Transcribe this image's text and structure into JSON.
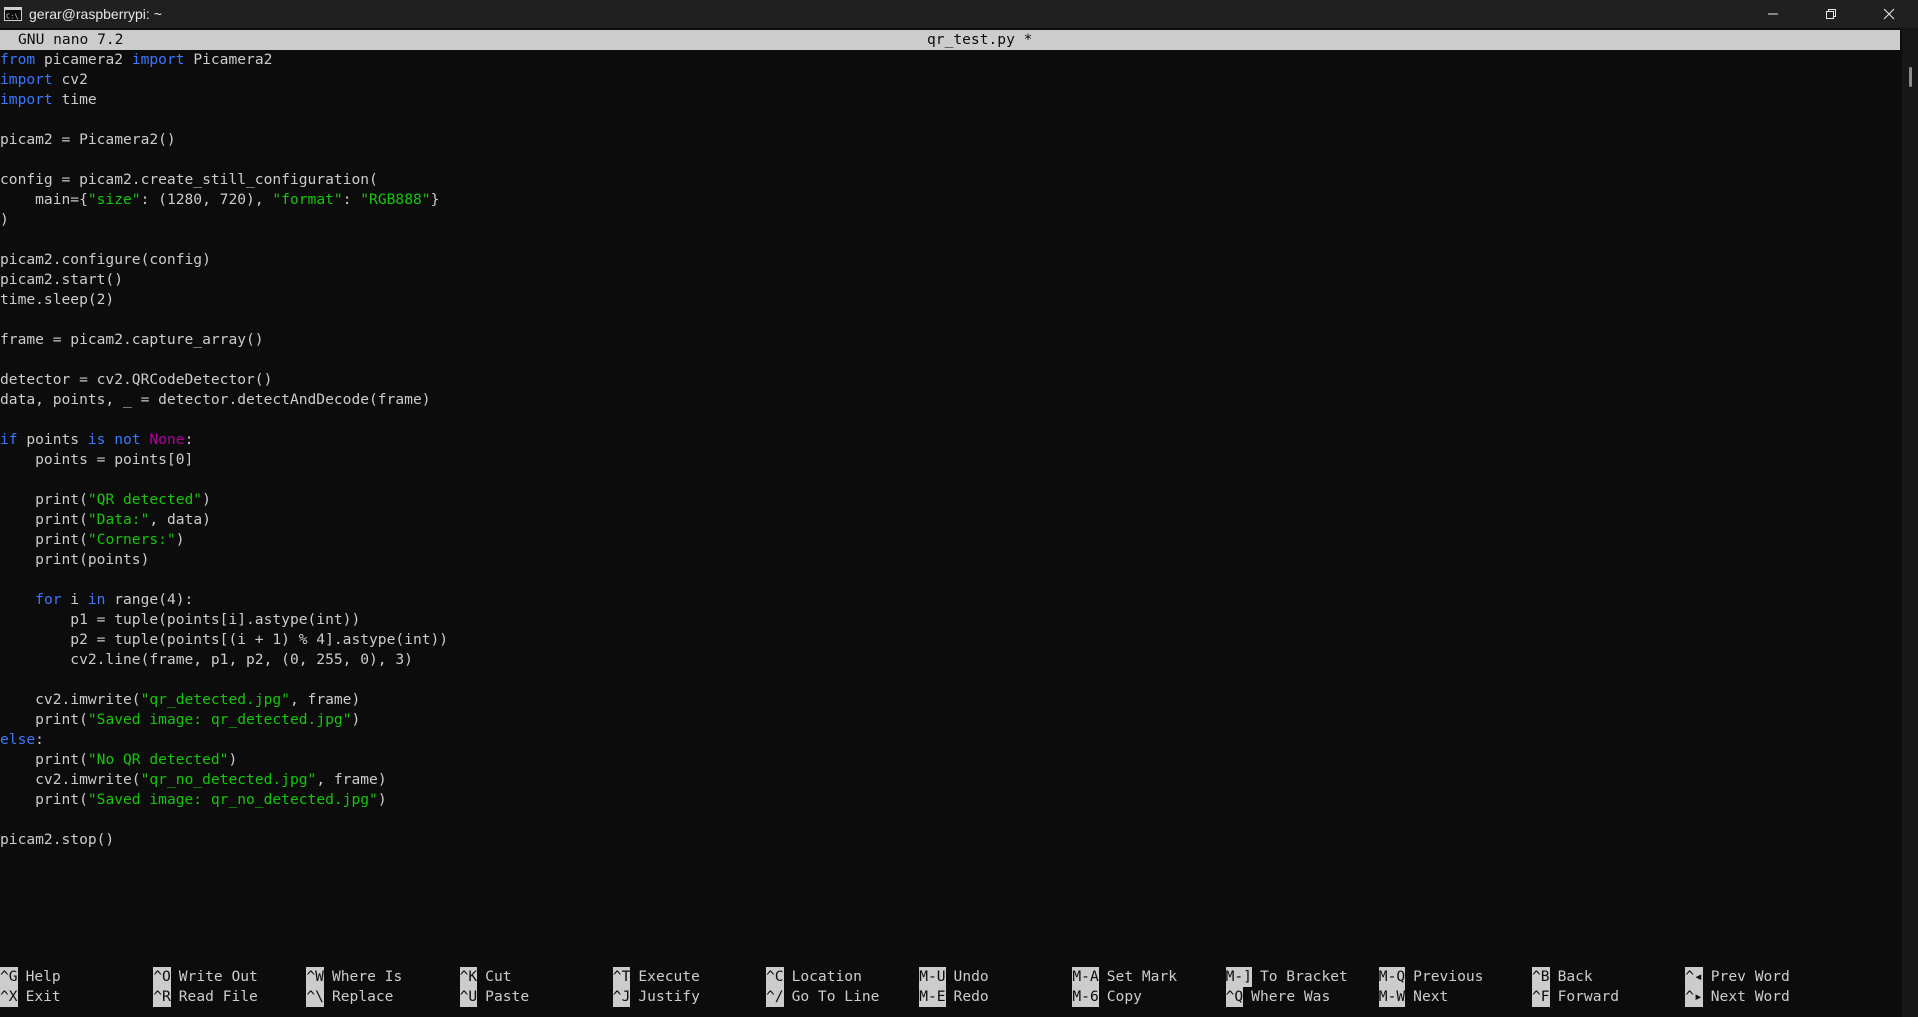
{
  "window": {
    "title": "gerar@raspberrypi: ~",
    "icon": "terminal-icon",
    "controls": [
      "minimize-icon",
      "restore-icon",
      "close-icon"
    ]
  },
  "nano": {
    "version": "GNU nano 7.2",
    "filename": "qr_test.py *"
  },
  "code_lines": [
    [
      {
        "t": "from",
        "c": "kw"
      },
      {
        "t": " picamera2 "
      },
      {
        "t": "import",
        "c": "kw"
      },
      {
        "t": " Picamera2"
      }
    ],
    [
      {
        "t": "import",
        "c": "kw"
      },
      {
        "t": " cv2"
      }
    ],
    [
      {
        "t": "import",
        "c": "kw"
      },
      {
        "t": " time"
      }
    ],
    [],
    [
      {
        "t": "picam2 = Picamera2()"
      }
    ],
    [],
    [
      {
        "t": "config = picam2.create_still_configuration("
      }
    ],
    [
      {
        "t": "    main={"
      },
      {
        "t": "\"size\"",
        "c": "str"
      },
      {
        "t": ": (1280, 720), "
      },
      {
        "t": "\"format\"",
        "c": "str"
      },
      {
        "t": ": "
      },
      {
        "t": "\"RGB888\"",
        "c": "str"
      },
      {
        "t": "}"
      }
    ],
    [
      {
        "t": ")"
      }
    ],
    [],
    [
      {
        "t": "picam2.configure(config)"
      }
    ],
    [
      {
        "t": "picam2.start()"
      }
    ],
    [
      {
        "t": "time.sleep(2)"
      }
    ],
    [],
    [
      {
        "t": "frame = picam2.capture_array()"
      }
    ],
    [],
    [
      {
        "t": "detector = cv2.QRCodeDetector()"
      }
    ],
    [
      {
        "t": "data, points, _ = detector.detectAndDecode(frame)"
      }
    ],
    [],
    [
      {
        "t": "if",
        "c": "kw"
      },
      {
        "t": " points "
      },
      {
        "t": "is",
        "c": "kw"
      },
      {
        "t": " "
      },
      {
        "t": "not",
        "c": "kw"
      },
      {
        "t": " "
      },
      {
        "t": "None",
        "c": "none"
      },
      {
        "t": ":"
      }
    ],
    [
      {
        "t": "    points = points[0]"
      }
    ],
    [],
    [
      {
        "t": "    print("
      },
      {
        "t": "\"QR detected\"",
        "c": "str"
      },
      {
        "t": ")"
      }
    ],
    [
      {
        "t": "    print("
      },
      {
        "t": "\"Data:\"",
        "c": "str"
      },
      {
        "t": ", data)"
      }
    ],
    [
      {
        "t": "    print("
      },
      {
        "t": "\"Corners:\"",
        "c": "str"
      },
      {
        "t": ")"
      }
    ],
    [
      {
        "t": "    print(points)"
      }
    ],
    [],
    [
      {
        "t": "    "
      },
      {
        "t": "for",
        "c": "kw"
      },
      {
        "t": " i "
      },
      {
        "t": "in",
        "c": "kw"
      },
      {
        "t": " range(4):"
      }
    ],
    [
      {
        "t": "        p1 = tuple(points[i].astype(int))"
      }
    ],
    [
      {
        "t": "        p2 = tuple(points[(i + 1) % 4].astype(int))"
      }
    ],
    [
      {
        "t": "        cv2.line(frame, p1, p2, (0, 255, 0), 3)"
      }
    ],
    [],
    [
      {
        "t": "    cv2.imwrite("
      },
      {
        "t": "\"qr_detected.jpg\"",
        "c": "str"
      },
      {
        "t": ", frame)"
      }
    ],
    [
      {
        "t": "    print("
      },
      {
        "t": "\"Saved image: qr_detected.jpg\"",
        "c": "str"
      },
      {
        "t": ")"
      }
    ],
    [
      {
        "t": "else",
        "c": "kw"
      },
      {
        "t": ":"
      }
    ],
    [
      {
        "t": "    print("
      },
      {
        "t": "\"No QR detected\"",
        "c": "str"
      },
      {
        "t": ")"
      }
    ],
    [
      {
        "t": "    cv2.imwrite("
      },
      {
        "t": "\"qr_no_detected.jpg\"",
        "c": "str"
      },
      {
        "t": ", frame)"
      }
    ],
    [
      {
        "t": "    print("
      },
      {
        "t": "\"Saved image: qr_no_detected.jpg\"",
        "c": "str"
      },
      {
        "t": ")"
      }
    ],
    [],
    [
      {
        "t": "picam2.stop()"
      }
    ]
  ],
  "shortcuts": [
    [
      {
        "key": "^G",
        "label": "Help"
      },
      {
        "key": "^O",
        "label": "Write Out"
      },
      {
        "key": "^W",
        "label": "Where Is"
      },
      {
        "key": "^K",
        "label": "Cut"
      },
      {
        "key": "^T",
        "label": "Execute"
      },
      {
        "key": "^C",
        "label": "Location"
      },
      {
        "key": "M-U",
        "label": "Undo"
      },
      {
        "key": "M-A",
        "label": "Set Mark"
      },
      {
        "key": "M-]",
        "label": "To Bracket"
      },
      {
        "key": "M-Q",
        "label": "Previous"
      },
      {
        "key": "^B",
        "label": "Back"
      },
      {
        "key": "^◂",
        "label": "Prev Word"
      }
    ],
    [
      {
        "key": "^X",
        "label": "Exit"
      },
      {
        "key": "^R",
        "label": "Read File"
      },
      {
        "key": "^\\",
        "label": "Replace"
      },
      {
        "key": "^U",
        "label": "Paste"
      },
      {
        "key": "^J",
        "label": "Justify"
      },
      {
        "key": "^/",
        "label": "Go To Line"
      },
      {
        "key": "M-E",
        "label": "Redo"
      },
      {
        "key": "M-6",
        "label": "Copy"
      },
      {
        "key": "^Q",
        "label": "Where Was"
      },
      {
        "key": "M-W",
        "label": "Next"
      },
      {
        "key": "^F",
        "label": "Forward"
      },
      {
        "key": "^▸",
        "label": "Next Word"
      }
    ]
  ],
  "colors": {
    "keyword": "#3b78ff",
    "string": "#16c60c",
    "constant": "#b4009e",
    "text": "#cccccc",
    "background": "#0c0c0c"
  }
}
